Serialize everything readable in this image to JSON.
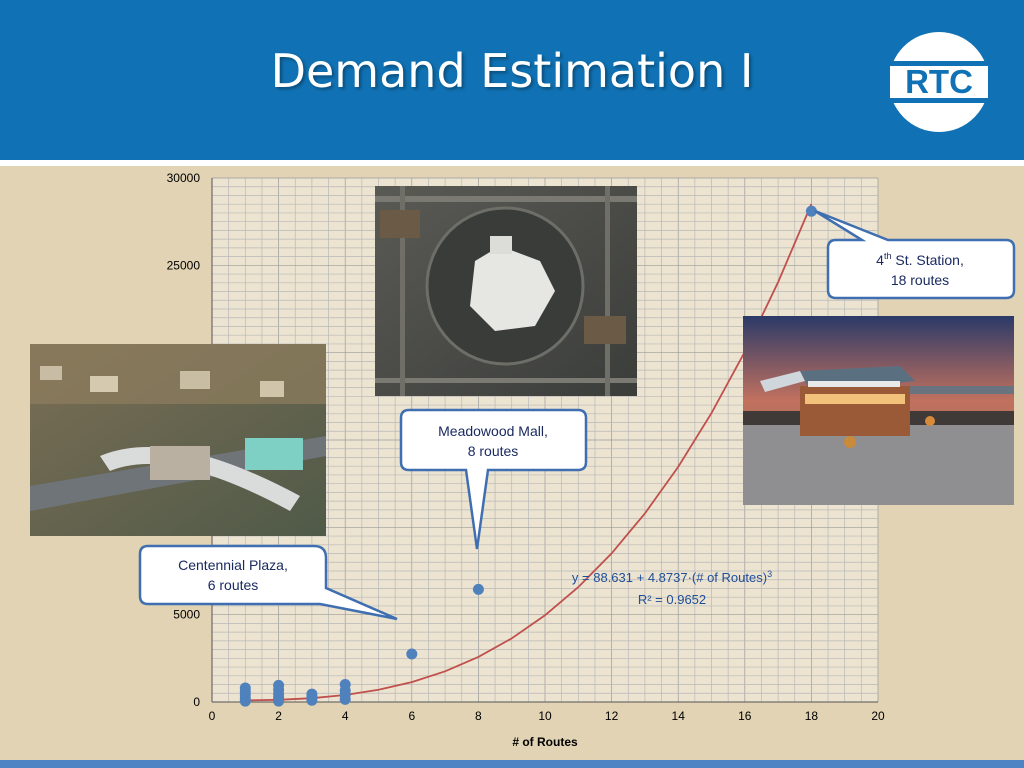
{
  "slide": {
    "title": "Demand Estimation I",
    "logo_text": "RTC"
  },
  "colors": {
    "header": "#1072b4",
    "background": "#e1d3b3",
    "grid": "#a9a9a9",
    "fit_line": "#c0504d",
    "points": "#4f81bd",
    "callout_border": "#3f6fb0",
    "bottom_bar": "#4e84c4"
  },
  "photos": [
    {
      "name": "centennial-plaza-photo",
      "icon": "aerial-photo-transit-center"
    },
    {
      "name": "meadowood-mall-photo",
      "icon": "satellite-photo-mall"
    },
    {
      "name": "4th-st-station-photo",
      "icon": "night-photo-bus-station"
    }
  ],
  "callouts": {
    "centennial": {
      "line1": "Centennial Plaza,",
      "line2": "6 routes"
    },
    "meadowood": {
      "line1": "Meadowood Mall,",
      "line2": "8 routes"
    },
    "fourth_st": {
      "line1_pre": "4",
      "line1_sup": "th",
      "line1_post": " St. Station,",
      "line2": "18 routes"
    }
  },
  "equation": {
    "line1": "y = 88.631 + 4.8737·(# of Routes)",
    "line1_sup": "3",
    "line2": "R² = 0.9652"
  },
  "chart_data": {
    "type": "scatter",
    "title": "",
    "xlabel": "# of Routes",
    "ylabel": "",
    "xlim": [
      0,
      20
    ],
    "ylim": [
      0,
      30000
    ],
    "x_ticks": [
      "0",
      "2",
      "4",
      "6",
      "8",
      "10",
      "12",
      "14",
      "16",
      "18",
      "20"
    ],
    "y_ticks": [
      "0",
      "5000",
      "25000",
      "30000"
    ],
    "grid": true,
    "series": [
      {
        "points": [
          {
            "x": 1,
            "y": 50
          },
          {
            "x": 1,
            "y": 200
          },
          {
            "x": 1,
            "y": 400
          },
          {
            "x": 1,
            "y": 600
          },
          {
            "x": 1,
            "y": 800
          },
          {
            "x": 2,
            "y": 50
          },
          {
            "x": 2,
            "y": 250
          },
          {
            "x": 2,
            "y": 450
          },
          {
            "x": 2,
            "y": 700
          },
          {
            "x": 2,
            "y": 950
          },
          {
            "x": 3,
            "y": 100
          },
          {
            "x": 3,
            "y": 300
          },
          {
            "x": 3,
            "y": 450
          },
          {
            "x": 4,
            "y": 150
          },
          {
            "x": 4,
            "y": 400
          },
          {
            "x": 4,
            "y": 650
          },
          {
            "x": 4,
            "y": 1000
          },
          {
            "x": 6,
            "y": 2750
          },
          {
            "x": 8,
            "y": 6450
          },
          {
            "x": 18,
            "y": 28100
          }
        ]
      },
      {
        "type": "line",
        "equation": "y = 88.631 + 4.8737·x³",
        "x": [
          1,
          2,
          3,
          4,
          5,
          6,
          7,
          8,
          9,
          10,
          11,
          12,
          13,
          14,
          15,
          16,
          17,
          18
        ],
        "y": [
          93.5,
          127.6,
          220.2,
          400.5,
          697.8,
          1141.3,
          1760.3,
          2584.0,
          3641.6,
          4962.3,
          6575.5,
          8510.3,
          10796.1,
          13462.2,
          16537.5,
          20051.5,
          24033.3,
          28512.4
        ]
      }
    ]
  }
}
